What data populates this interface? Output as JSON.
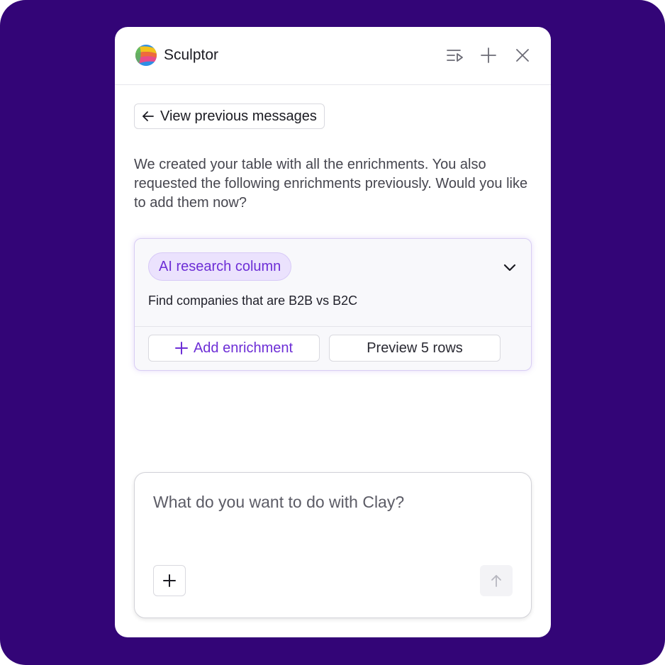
{
  "header": {
    "title": "Sculptor",
    "icons": [
      "sculptor-logo-icon",
      "history-list-icon",
      "new-chat-plus-icon",
      "close-icon"
    ]
  },
  "back_button": {
    "label": "View previous messages",
    "icon": "arrow-left-icon"
  },
  "message": "We created your table with all the enrichments. You also requested the following enrichments previously. Would you like to add them now?",
  "enrichment_card": {
    "tag": "AI research column",
    "description": "Find companies that are B2B vs B2C",
    "add_label": "Add enrichment",
    "preview_label": "Preview 5 rows"
  },
  "composer": {
    "placeholder": "What do you want to do with Clay?",
    "value": ""
  },
  "colors": {
    "background": "#330577",
    "accent": "#6d2ed6",
    "pill_bg": "#ebe2fd"
  }
}
